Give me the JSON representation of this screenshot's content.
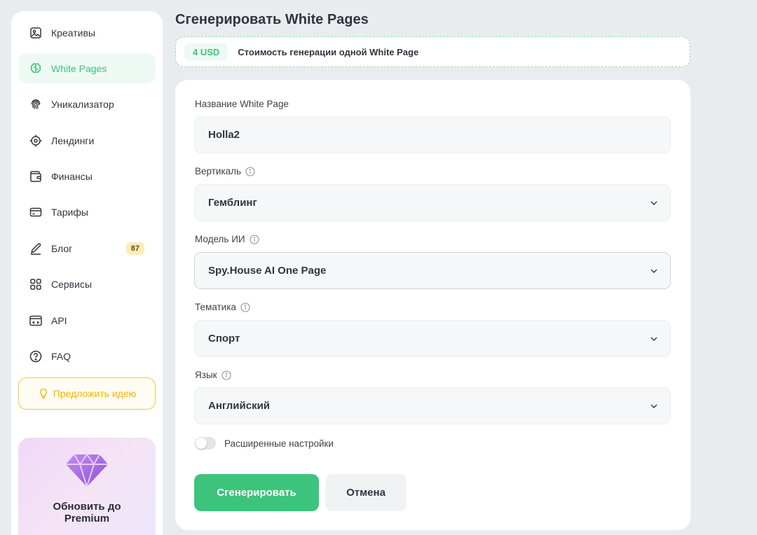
{
  "sidebar": {
    "items": [
      {
        "label": "Креативы",
        "icon": "image-icon"
      },
      {
        "label": "White Pages",
        "icon": "brain-icon",
        "active": true
      },
      {
        "label": "Уникализатор",
        "icon": "fingerprint-icon"
      },
      {
        "label": "Лендинги",
        "icon": "target-icon"
      },
      {
        "label": "Финансы",
        "icon": "wallet-icon"
      },
      {
        "label": "Тарифы",
        "icon": "card-icon"
      },
      {
        "label": "Блог",
        "icon": "pen-icon",
        "badge": "87"
      },
      {
        "label": "Сервисы",
        "icon": "grid-icon"
      },
      {
        "label": "API",
        "icon": "code-icon"
      },
      {
        "label": "FAQ",
        "icon": "question-icon"
      }
    ],
    "idea_button": "Предложить идею",
    "premium": {
      "text": "Обновить до Premium"
    }
  },
  "page": {
    "title": "Сгенерировать White Pages",
    "cost": {
      "amount": "4 USD",
      "text": "Стоимость генерации одной White Page"
    }
  },
  "form": {
    "name": {
      "label": "Название White Page",
      "value": "Holla2"
    },
    "vertical": {
      "label": "Вертикаль",
      "value": "Гемблинг"
    },
    "model": {
      "label": "Модель ИИ",
      "value": "Spy.House AI One Page"
    },
    "topic": {
      "label": "Тематика",
      "value": "Спорт"
    },
    "language": {
      "label": "Язык",
      "value": "Английский"
    },
    "advanced": {
      "label": "Расширенные настройки",
      "enabled": false
    },
    "submit": "Сгенерировать",
    "cancel": "Отмена"
  },
  "colors": {
    "accent": "#3cc47c",
    "warning": "#f5c842",
    "background": "#e9ecef"
  }
}
